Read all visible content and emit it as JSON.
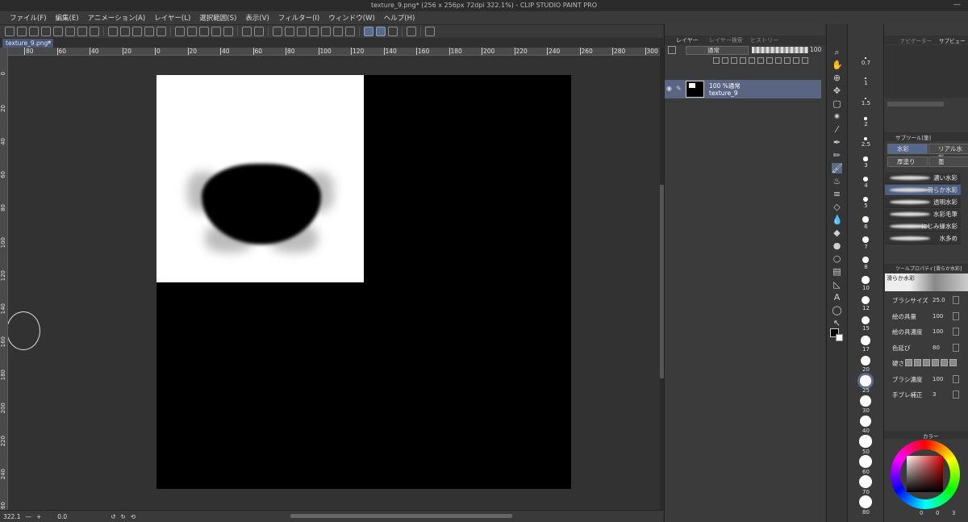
{
  "window": {
    "title": "texture_9.png* (256 x 256px 72dpi 322.1%) - CLIP STUDIO PAINT PRO"
  },
  "menu": [
    "ファイル(F)",
    "編集(E)",
    "アニメーション(A)",
    "レイヤー(L)",
    "選択範囲(S)",
    "表示(V)",
    "フィルター(I)",
    "ウィンドウ(W)",
    "ヘルプ(H)"
  ],
  "tab": {
    "label": "texture_9.png*"
  },
  "ruler": {
    "h_labels": [
      "80",
      "60",
      "40",
      "20",
      "0",
      "20",
      "40",
      "60",
      "80",
      "100",
      "120",
      "140",
      "160",
      "180",
      "200",
      "220",
      "240",
      "260",
      "280",
      "300"
    ],
    "v_labels": [
      "0",
      "20",
      "40",
      "60",
      "80",
      "100",
      "120",
      "140",
      "160",
      "180",
      "200",
      "220",
      "240",
      "260"
    ]
  },
  "status": {
    "zoom": "322.1",
    "angle": "0.0"
  },
  "layer_panel": {
    "tab_layer": "レイヤー",
    "tab_layer_prop": "レイヤー検索",
    "tab_history": "ヒストリー",
    "blend_mode": "通常",
    "opacity": "100",
    "layer": {
      "mode_line": "100 %通常",
      "name": "texture_9"
    }
  },
  "brush_sizes": [
    "0.7",
    "1",
    "1.5",
    "2",
    "2.5",
    "3",
    "4",
    "5",
    "6",
    "7",
    "8",
    "10",
    "12",
    "15",
    "17",
    "20",
    "25",
    "30",
    "40",
    "50",
    "60",
    "70",
    "80"
  ],
  "right_panel": {
    "tab_nav": "ナビゲーター",
    "tab_sub": "サブビュー",
    "subtool_header": "サブツール[筆]",
    "subtools": [
      "水彩",
      "リアル水彩",
      "厚塗り",
      "墨"
    ],
    "brushes": [
      "濃い水彩",
      "滑らか水彩",
      "透明水彩",
      "水彩毛筆",
      "にじみ縁水彩",
      "水多め"
    ],
    "prop_header": "ツールプロパティ[滑らか水彩]",
    "prop_preview": "滑らか水彩",
    "props": [
      {
        "label": "ブラシサイズ",
        "value": "25.0"
      },
      {
        "label": "絵の具量",
        "value": "100"
      },
      {
        "label": "絵の具濃度",
        "value": "100"
      },
      {
        "label": "色延び",
        "value": "80"
      },
      {
        "label": "硬さ",
        "value": ""
      },
      {
        "label": "ブラシ濃度",
        "value": "100"
      },
      {
        "label": "手ブレ補正",
        "value": "3"
      }
    ],
    "color_tab": "カラー",
    "color_values": [
      "0",
      "0",
      "3"
    ]
  }
}
